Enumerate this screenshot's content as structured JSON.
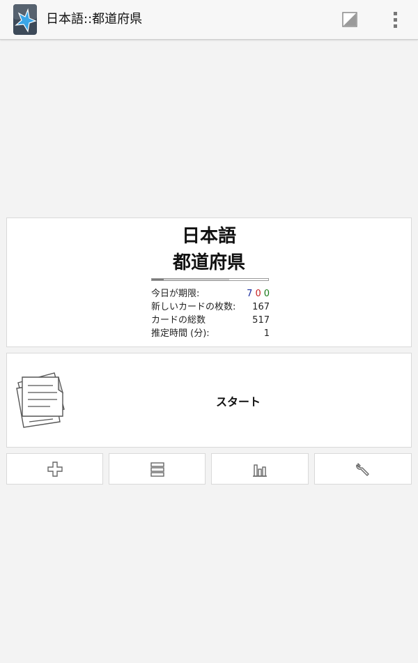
{
  "app": {
    "title": "日本語::都道府県"
  },
  "actionbar": {
    "app_icon": "ankidroid-star-icon",
    "sync_icon": "sync-status-icon",
    "overflow_icon": "overflow-menu-icon"
  },
  "deck": {
    "title_line1": "日本語",
    "title_line2": "都道府県",
    "progress": {
      "reviewed_fraction": 0.1,
      "secondary_fraction": 0.56
    },
    "stats": {
      "due_label": "今日が期限:",
      "due_new": "7",
      "due_learning": "0",
      "due_review": "0",
      "new_cards_label": "新しいカードの枚数:",
      "new_cards_value": "167",
      "total_cards_label": "カードの総数",
      "total_cards_value": "517",
      "est_time_label": "推定時間 (分):",
      "est_time_value": "1"
    },
    "colors": {
      "new": "#1b2fa0",
      "learning": "#c62020",
      "review": "#1a7a1a"
    }
  },
  "start": {
    "label": "スタート",
    "icon": "study-cards-icon"
  },
  "toolbar": {
    "add_icon": "add-icon",
    "browse_icon": "browse-list-icon",
    "stats_icon": "statistics-icon",
    "options_icon": "wrench-icon"
  }
}
